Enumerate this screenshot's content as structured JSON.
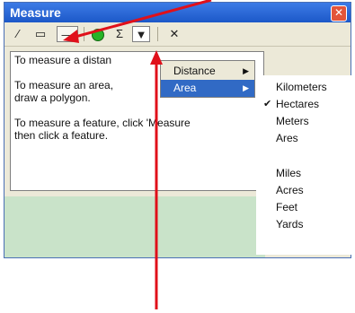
{
  "window": {
    "title": "Measure",
    "close_glyph": "✕"
  },
  "toolbar": {
    "line_tool_glyph": "⁄",
    "area_tool_glyph": "▭",
    "feature_tool_glyph": "—",
    "circle_tool_icon": "green-circle",
    "sum_tool_glyph": "Σ",
    "units_dropdown_glyph": "▼",
    "clear_tool_glyph": "✕"
  },
  "content": {
    "line1": "To measure a distan",
    "line2a": "To measure an area,",
    "line2b": "draw a polygon.",
    "line3a": "To measure a feature, click 'Measure",
    "line3b": "then click a feature."
  },
  "menu1": {
    "items": [
      {
        "label": "Distance",
        "arrow": "▶"
      },
      {
        "label": "Area",
        "arrow": "▶"
      }
    ]
  },
  "menu2": {
    "items": [
      {
        "label": "Kilometers"
      },
      {
        "label": "Hectares",
        "checked": "✔"
      },
      {
        "label": "Meters"
      },
      {
        "label": "Ares"
      },
      {
        "label": "Miles"
      },
      {
        "label": "Acres"
      },
      {
        "label": "Feet"
      },
      {
        "label": "Yards"
      }
    ]
  },
  "colors": {
    "annotation_arrow": "#e0101a",
    "menu_highlight": "#316ac5",
    "titlebar": "#1c58c8"
  }
}
